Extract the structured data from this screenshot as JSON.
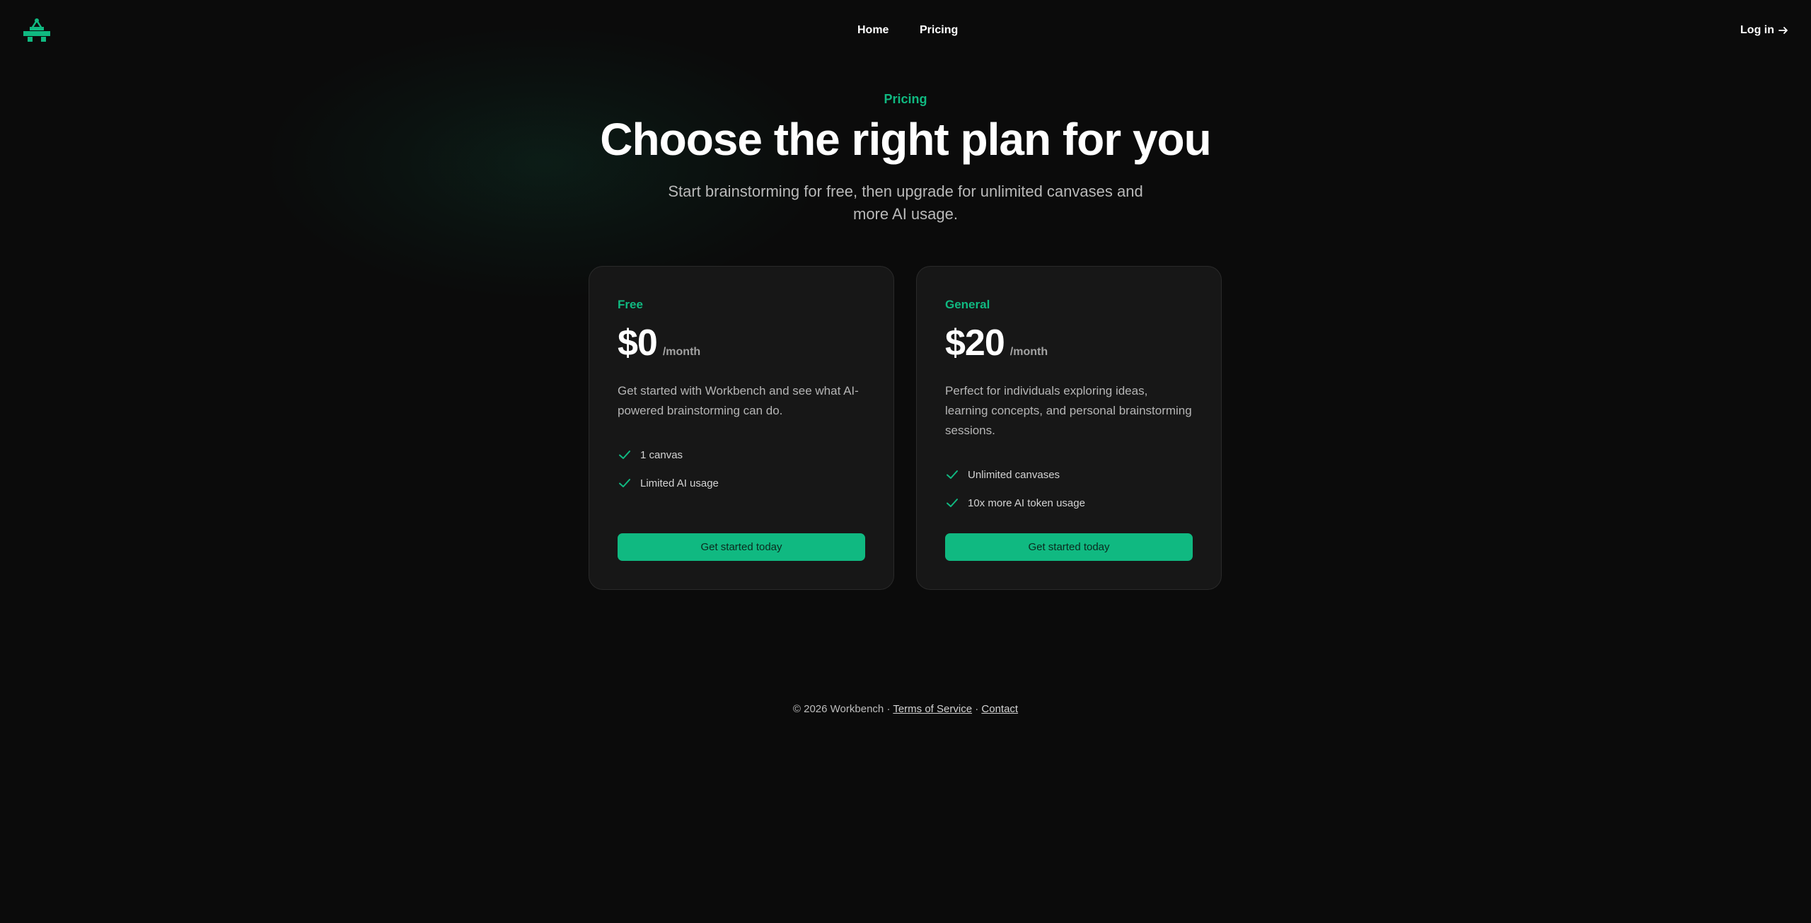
{
  "nav": {
    "logo_icon": "workbench-logo-icon",
    "home": "Home",
    "pricing": "Pricing",
    "login": "Log in",
    "login_icon": "arrow-right-icon"
  },
  "hero": {
    "eyebrow": "Pricing",
    "title": "Choose the right plan for you",
    "subtitle": "Start brainstorming for free, then upgrade for unlimited canvases and more AI usage."
  },
  "plans": [
    {
      "name": "Free",
      "price": "$0",
      "period": "/month",
      "description": "Get started with Workbench and see what AI-powered brainstorming can do.",
      "features": [
        "1 canvas",
        "Limited AI usage"
      ],
      "cta": "Get started today"
    },
    {
      "name": "General",
      "price": "$20",
      "period": "/month",
      "description": "Perfect for individuals exploring ideas, learning concepts, and personal brainstorming sessions.",
      "features": [
        "Unlimited canvases",
        "10x more AI token usage"
      ],
      "cta": "Get started today"
    }
  ],
  "footer": {
    "copyright": "© 2026 Workbench",
    "sep1": "·",
    "terms": "Terms of Service",
    "sep2": "·",
    "contact": "Contact"
  },
  "colors": {
    "accent": "#10b981",
    "background": "#0b0b0b",
    "card": "#171717"
  }
}
